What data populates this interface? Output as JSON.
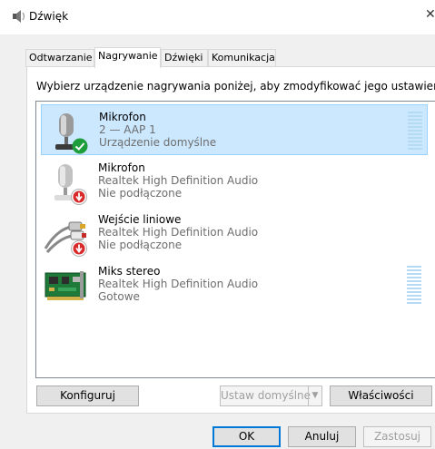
{
  "window": {
    "title": "Dźwięk"
  },
  "tabs": [
    {
      "label": "Odtwarzanie"
    },
    {
      "label": "Nagrywanie"
    },
    {
      "label": "Dźwięki"
    },
    {
      "label": "Komunikacja"
    }
  ],
  "active_tab": "Nagrywanie",
  "instruction": "Wybierz urządzenie nagrywania poniżej, aby zmodyfikować jego ustawienia:",
  "devices": [
    {
      "name": "Mikrofon",
      "subtitle": "2 — AAP 1",
      "status": "Urządzenie domyślne",
      "icon": "microphone-icon",
      "badge": "default-check-icon",
      "selected": true
    },
    {
      "name": "Mikrofon",
      "subtitle": "Realtek High Definition Audio",
      "status": "Nie podłączone",
      "icon": "microphone-icon",
      "badge": "unplugged-icon",
      "selected": false
    },
    {
      "name": "Wejście liniowe",
      "subtitle": "Realtek High Definition Audio",
      "status": "Nie podłączone",
      "icon": "line-in-icon",
      "badge": "unplugged-icon",
      "selected": false
    },
    {
      "name": "Miks stereo",
      "subtitle": "Realtek High Definition Audio",
      "status": "Gotowe",
      "icon": "sound-card-icon",
      "badge": "",
      "selected": false
    }
  ],
  "buttons": {
    "configure": "Konfiguruj",
    "set_default": "Ustaw domyślne",
    "properties": "Właściwości",
    "ok": "OK",
    "cancel": "Anuluj",
    "apply": "Zastosuj"
  },
  "colors": {
    "selection": "#cce8ff",
    "selection_border": "#99d1ff",
    "default_check": "#1e9e3a",
    "unplugged_badge": "#d82a2a",
    "level_meter": "#b5daf4"
  }
}
